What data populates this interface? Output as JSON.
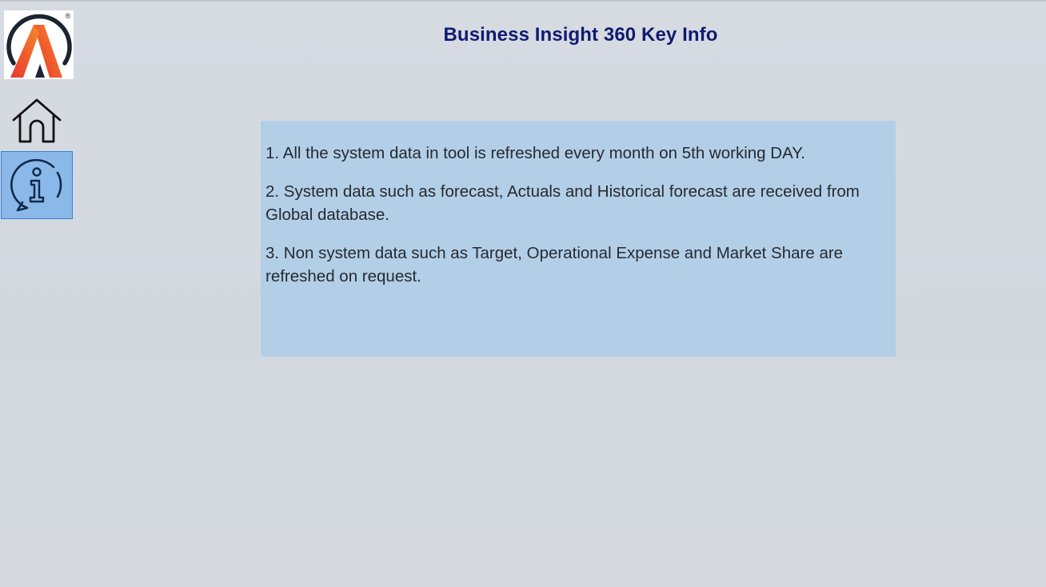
{
  "app": {
    "title": "Business Insight 360 Key Info"
  },
  "logo": {
    "icon": "brand-logo-icon",
    "registered_mark": "®"
  },
  "nav": {
    "items": [
      {
        "icon": "home-icon",
        "active": false
      },
      {
        "icon": "info-icon",
        "active": true
      }
    ]
  },
  "info": {
    "items": [
      "1.  All the system data in tool is refreshed every month on 5th working DAY.",
      "2.  System data such as forecast, Actuals and Historical forecast are received from Global database.",
      "3.  Non system data such as Target, Operational Expense and Market Share are refreshed on request."
    ]
  },
  "colors": {
    "title": "#111a70",
    "panel_background": "#b3cfe7",
    "active_nav_background": "#8ab8e8",
    "active_nav_border": "#3a7fd0",
    "logo_orange": "#ef6a2c",
    "logo_red": "#e23a3a"
  }
}
